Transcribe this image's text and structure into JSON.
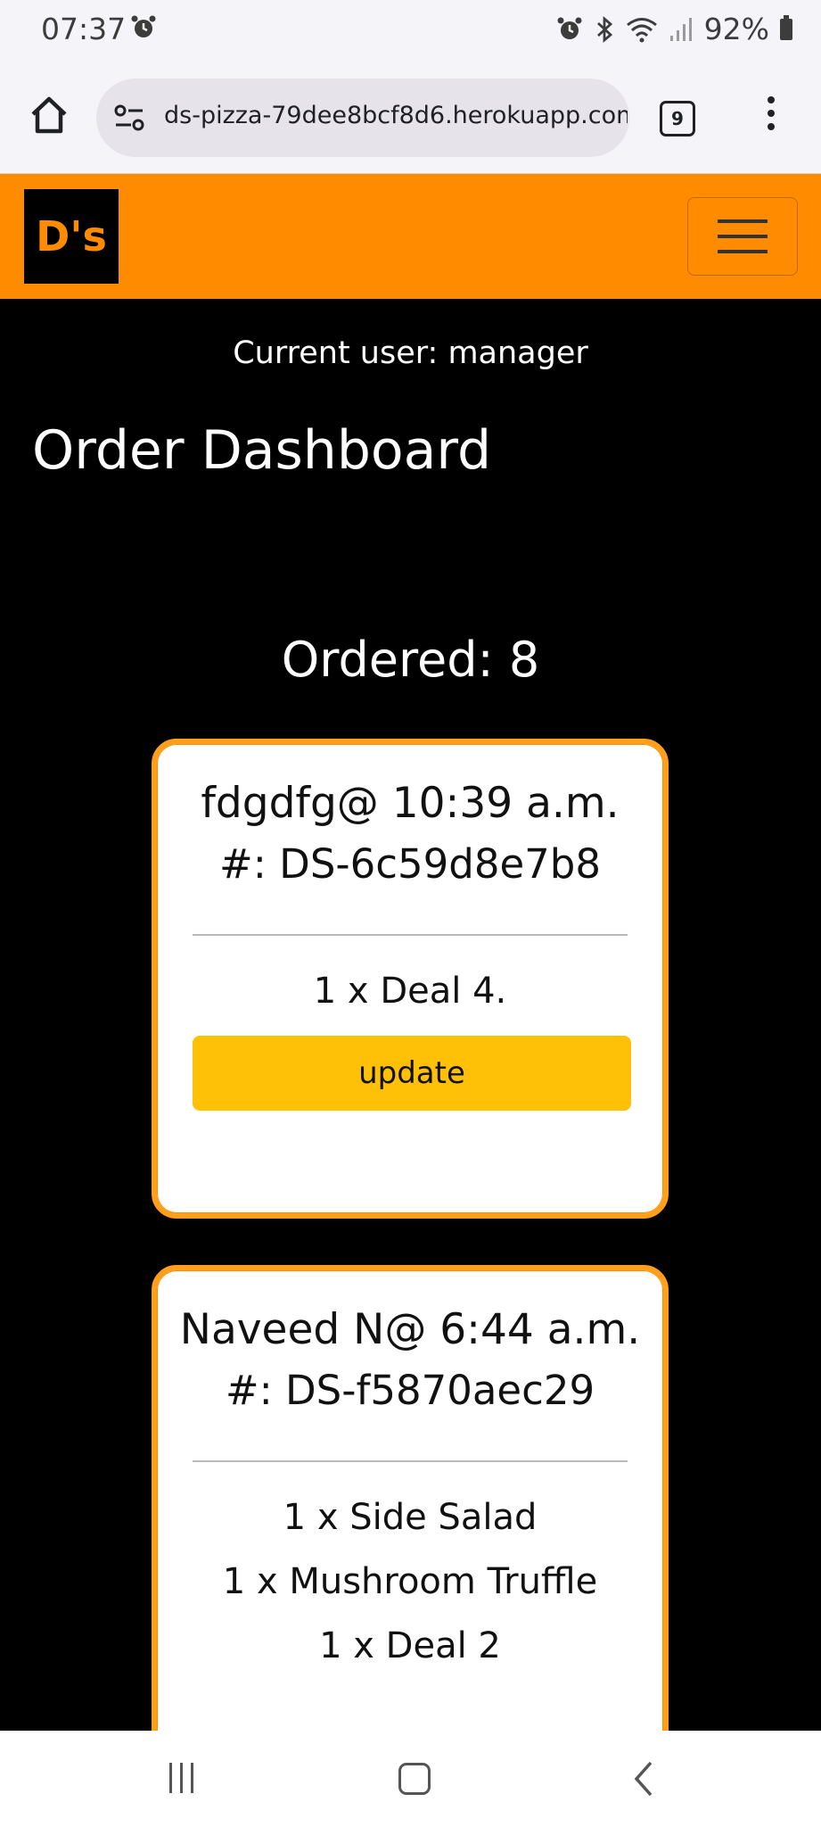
{
  "status_bar": {
    "time": "07:37",
    "battery": "92%"
  },
  "browser": {
    "url": "ds-pizza-79dee8bcf8d6.herokuapp.com",
    "tab_count": "9"
  },
  "navbar": {
    "logo": "D's"
  },
  "page": {
    "current_user": "Current user: manager",
    "title": "Order Dashboard",
    "ordered_heading": "Ordered: 8"
  },
  "orders": [
    {
      "head": "fdgdfg@ 10:39 a.m.",
      "number": "#: DS-6c59d8e7b8",
      "items": [
        "1 x Deal 4."
      ],
      "button": "update"
    },
    {
      "head": "Naveed N@ 6:44 a.m.",
      "number": "#: DS-f5870aec29",
      "items": [
        "1 x Side Salad",
        "1 x Mushroom Truffle",
        "1 x Deal 2"
      ]
    }
  ],
  "colors": {
    "brand_orange": "#ff8c00",
    "update_yellow": "#ffc107",
    "background": "#000000"
  }
}
